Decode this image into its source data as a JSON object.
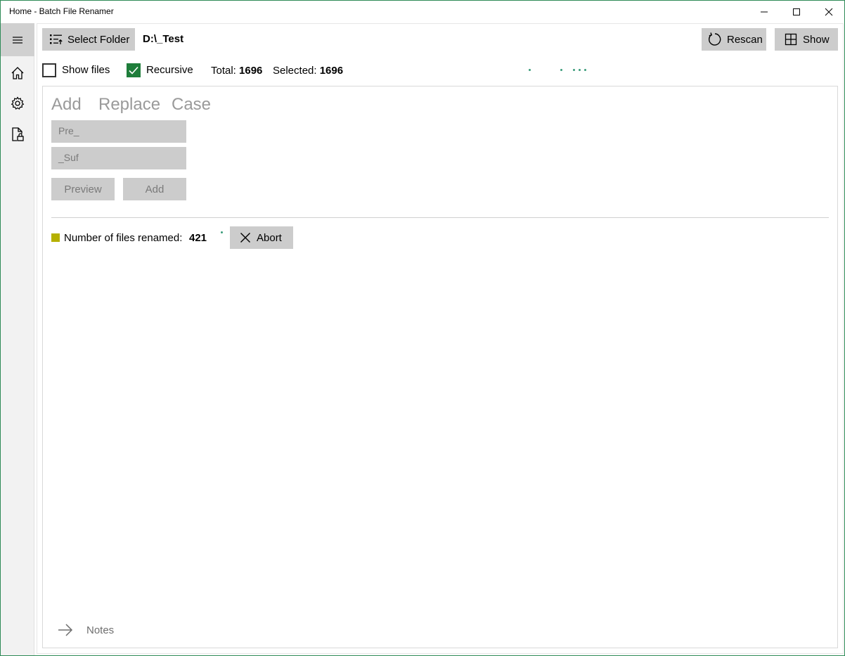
{
  "window": {
    "title": "Home - Batch File Renamer"
  },
  "toolbar": {
    "select_folder_label": "Select Folder",
    "folder_path": "D:\\_Test",
    "rescan_label": "Rescan",
    "show_label": "Show"
  },
  "options": {
    "show_files_label": "Show files",
    "show_files_checked": false,
    "recursive_label": "Recursive",
    "recursive_checked": true,
    "total_label": "Total:",
    "total_value": "1696",
    "selected_label": "Selected:",
    "selected_value": "1696"
  },
  "tabs": [
    "Add",
    "Replace",
    "Case"
  ],
  "add_form": {
    "prefix_placeholder": "Pre_",
    "suffix_placeholder": "_Suf",
    "preview_label": "Preview",
    "add_label": "Add"
  },
  "status": {
    "renamed_label": "Number of files renamed:",
    "renamed_count": "421",
    "abort_label": "Abort",
    "indicator_color": "#b5b000"
  },
  "footer": {
    "notes_label": "Notes"
  },
  "colors": {
    "accent": "#1e7d3a",
    "progress_dots": "#3a9c7a"
  }
}
